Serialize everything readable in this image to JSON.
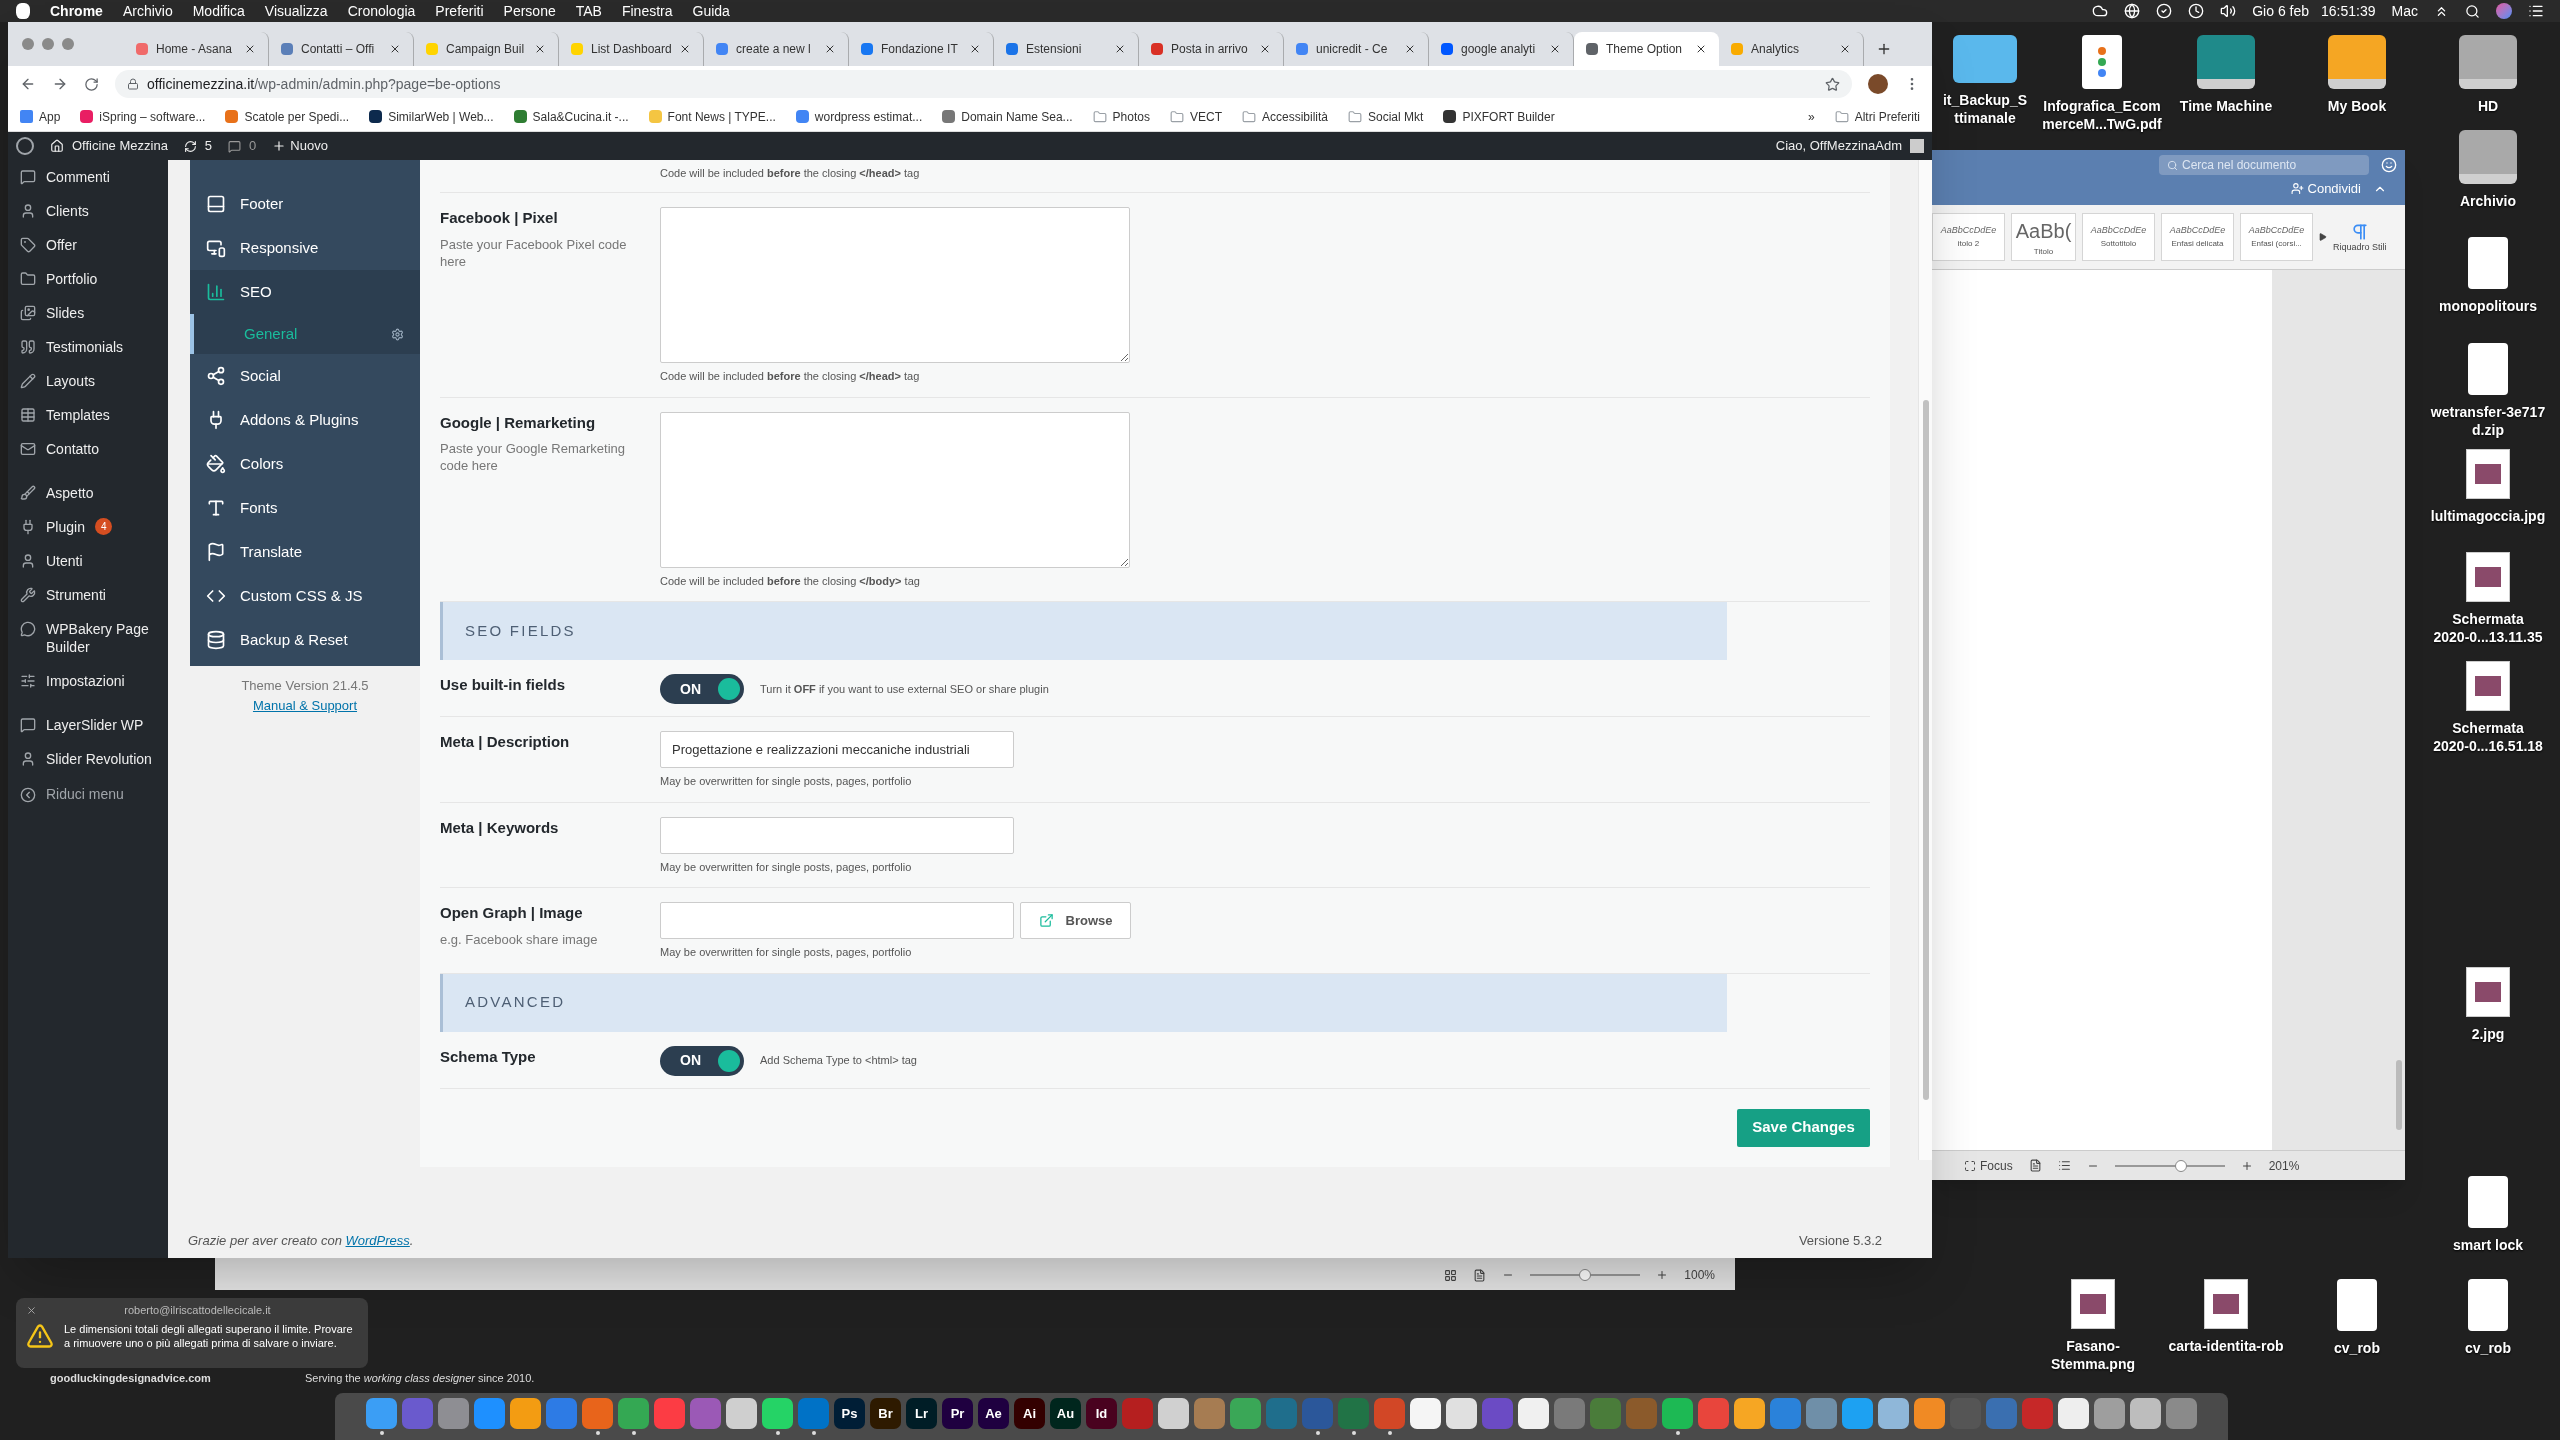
{
  "mac_menubar": {
    "app": "Chrome",
    "menus": [
      "Archivio",
      "Modifica",
      "Visualizza",
      "Cronologia",
      "Preferiti",
      "Persone",
      "TAB",
      "Finestra",
      "Guida"
    ],
    "date": "Gio 6 feb",
    "time": "16:51:39",
    "user": "Mac"
  },
  "browser": {
    "tabs": [
      {
        "title": "Home - Asana",
        "color": "#f06a6a",
        "selected": false
      },
      {
        "title": "Contatti – Offi",
        "color": "#5b7fb8",
        "selected": false
      },
      {
        "title": "Campaign Buil",
        "color": "#ffd400",
        "selected": false
      },
      {
        "title": "List Dashboard",
        "color": "#ffd400",
        "selected": false
      },
      {
        "title": "create a new l",
        "color": "#4285f4",
        "selected": false
      },
      {
        "title": "Fondazione IT",
        "color": "#1877f2",
        "selected": false
      },
      {
        "title": "Estensioni",
        "color": "#1a73e8",
        "selected": false
      },
      {
        "title": "Posta in arrivo",
        "color": "#d93025",
        "selected": false
      },
      {
        "title": "unicredit - Ce",
        "color": "#4285f4",
        "selected": false
      },
      {
        "title": "google analyti",
        "color": "#0057ff",
        "selected": false
      },
      {
        "title": "Theme Option",
        "color": "#5f6368",
        "selected": true
      },
      {
        "title": "Analytics",
        "color": "#f9ab00",
        "selected": false
      }
    ],
    "url_host": "officinemezzina.it",
    "url_path": "/wp-admin/admin.php?page=be-options",
    "bookmarks": [
      {
        "label": "App",
        "kind": "apps",
        "color": "#4285f4"
      },
      {
        "label": "iSpring – software...",
        "kind": "site",
        "color": "#e91e63"
      },
      {
        "label": "Scatole per Spedi...",
        "kind": "site",
        "color": "#e8711a"
      },
      {
        "label": "SimilarWeb | Web...",
        "kind": "site",
        "color": "#0d2a4d"
      },
      {
        "label": "Sala&Cucina.it -...",
        "kind": "site",
        "color": "#2e7d32"
      },
      {
        "label": "Font News | TYPE...",
        "kind": "site",
        "color": "#f4c542"
      },
      {
        "label": "wordpress estimat...",
        "kind": "site",
        "color": "#4285f4"
      },
      {
        "label": "Domain Name Sea...",
        "kind": "site",
        "color": "#777777"
      },
      {
        "label": "Photos",
        "kind": "folder",
        "color": "#9aa0a6"
      },
      {
        "label": "VECT",
        "kind": "folder",
        "color": "#9aa0a6"
      },
      {
        "label": "Accessibilità",
        "kind": "folder",
        "color": "#9aa0a6"
      },
      {
        "label": "Social Mkt",
        "kind": "folder",
        "color": "#9aa0a6"
      },
      {
        "label": "PIXFORT Builder",
        "kind": "site",
        "color": "#333333"
      }
    ],
    "more": "»",
    "other": "Altri Preferiti"
  },
  "admin_bar": {
    "site": "Officine Mezzina",
    "updates": "5",
    "comments": "0",
    "new": "Nuovo",
    "greeting": "Ciao, OffMezzinaAdm"
  },
  "wp_menu": {
    "groups": [
      [
        {
          "label": "Commenti"
        },
        {
          "label": "Clients"
        },
        {
          "label": "Offer"
        },
        {
          "label": "Portfolio"
        },
        {
          "label": "Slides"
        },
        {
          "label": "Testimonials"
        },
        {
          "label": "Layouts"
        },
        {
          "label": "Templates"
        },
        {
          "label": "Contatto"
        }
      ],
      [
        {
          "label": "Aspetto"
        },
        {
          "label": "Plugin",
          "badge": "4"
        },
        {
          "label": "Utenti"
        },
        {
          "label": "Strumenti"
        },
        {
          "label": "WPBakery Page Builder"
        },
        {
          "label": "Impostazioni"
        }
      ],
      [
        {
          "label": "LayerSlider WP"
        },
        {
          "label": "Slider Revolution"
        }
      ]
    ],
    "collapse": "Riduci menu"
  },
  "theme_nav": {
    "items": [
      {
        "label": "Footer",
        "selected": false
      },
      {
        "label": "Responsive",
        "selected": false
      },
      {
        "label": "SEO",
        "selected": true,
        "children": [
          {
            "label": "General",
            "selected": true
          }
        ]
      },
      {
        "label": "Social",
        "selected": false
      },
      {
        "label": "Addons & Plugins",
        "selected": false
      },
      {
        "label": "Colors",
        "selected": false
      },
      {
        "label": "Fonts",
        "selected": false
      },
      {
        "label": "Translate",
        "selected": false
      },
      {
        "label": "Custom CSS & JS",
        "selected": false
      },
      {
        "label": "Backup & Reset",
        "selected": false
      }
    ],
    "version": "Theme Version 21.4.5",
    "support_link": "Manual & Support"
  },
  "form": {
    "top_note": "Code will be included **before** the closing **</head>** tag",
    "rows": [
      {
        "kind": "textarea",
        "label": "Facebook | Pixel",
        "hint": "Paste your Facebook Pixel code here",
        "note": "Code will be included **before** the closing **</head>** tag"
      },
      {
        "kind": "textarea",
        "label": "Google | Remarketing",
        "hint": "Paste your Google Remarketing code here",
        "note": "Code will be included **before** the closing **</body>** tag"
      },
      {
        "kind": "section",
        "title": "SEO FIELDS"
      },
      {
        "kind": "toggle",
        "label": "Use built-in fields",
        "toggle": "ON",
        "on": true,
        "note": "Turn it **OFF** if you want to use external SEO or share plugin"
      },
      {
        "kind": "input",
        "label": "Meta | Description",
        "value": "Progettazione e realizzazioni meccaniche industriali",
        "note": "May be overwritten for single posts, pages, portfolio"
      },
      {
        "kind": "input",
        "label": "Meta | Keywords",
        "note": "May be overwritten for single posts, pages, portfolio"
      },
      {
        "kind": "image",
        "label": "Open Graph | Image",
        "hint": "e.g. Facebook share image",
        "button": "Browse",
        "note": "May be overwritten for single posts, pages, portfolio"
      },
      {
        "kind": "section",
        "title": "ADVANCED"
      },
      {
        "kind": "toggle",
        "label": "Schema Type",
        "toggle": "ON",
        "on": true,
        "note": "Add Schema Type to <html> tag"
      }
    ],
    "save_button": "Save Changes"
  },
  "wp_footer": {
    "thanks": "Grazie per aver creato con",
    "link": "WordPress",
    "after": ".",
    "version": "Versione 5.3.2"
  },
  "word_window": {
    "search_placeholder": "Cerca nel documento",
    "share": "Condividi",
    "styles": [
      {
        "sample": "AaBbCcDdEe",
        "name": "itolo 2"
      },
      {
        "sample": "AaBb(",
        "name": "Titolo"
      },
      {
        "sample": "AaBbCcDdEe",
        "name": "Sottotitolo"
      },
      {
        "sample": "AaBbCcDdEe",
        "name": "Enfasi delicata"
      },
      {
        "sample": "AaBbCcDdEe",
        "name": "Enfasi (corsi..."
      }
    ],
    "styles_pane": "Riquadro Stili",
    "focus": "Focus",
    "zoom": "201%",
    "zoom_slider": {
      "level": 0.6
    }
  },
  "back_window": {
    "zoom": "100%",
    "zoom_slider": {
      "level": 0.5
    }
  },
  "desktop_icons": [
    {
      "lines": [
        "it_Backup_S",
        "ttimanale"
      ],
      "kind": "folder"
    },
    {
      "lines": [
        "Infografica_Ecom",
        "merceM...TwG.pdf"
      ],
      "kind": "pdf"
    },
    {
      "lines": [
        "Time Machine"
      ],
      "kind": "drive",
      "color": "#1f8a8a"
    },
    {
      "lines": [
        "My Book"
      ],
      "kind": "drive",
      "color": "#f5a623"
    },
    {
      "lines": [
        "HD"
      ],
      "kind": "drive",
      "color": "#a9a9a9"
    },
    {
      "lines": [
        "Archivio"
      ],
      "kind": "drive",
      "color": "#a9a9a9"
    },
    {
      "lines": [
        "monopolitours"
      ],
      "kind": "doc"
    },
    {
      "lines": [
        "wetransfer-3e717",
        "d.zip"
      ],
      "kind": "doc"
    },
    {
      "lines": [
        "lultimagoccia.jpg"
      ],
      "kind": "image"
    },
    {
      "lines": [
        "Schermata",
        "2020-0...13.11.35"
      ],
      "kind": "image"
    },
    {
      "lines": [
        "Schermata",
        "2020-0...16.51.18"
      ],
      "kind": "image"
    },
    {
      "lines": [
        "2.jpg"
      ],
      "kind": "image"
    },
    {
      "lines": [
        "smart lock"
      ],
      "kind": "doc"
    },
    {
      "lines": [
        "Fasano-",
        "Stemma.png"
      ],
      "kind": "image"
    },
    {
      "lines": [
        "carta-identita-rob"
      ],
      "kind": "image"
    },
    {
      "lines": [
        "cv_rob"
      ],
      "kind": "doc"
    },
    {
      "lines": [
        "cv_rob"
      ],
      "kind": "doc"
    }
  ],
  "notification": {
    "sender": "roberto@ilriscattodellecicale.it",
    "message": "Le dimensioni totali degli allegati superano il limite. Provare a rimuovere uno o più allegati prima di salvare o inviare."
  },
  "background_texts": [
    "goodluckingdesignadvice.com",
    "Serving the *working class designer* since 2010."
  ],
  "dock": [
    {
      "color": "#3b9ef5",
      "running": true
    },
    {
      "color": "#6a5acd",
      "running": false
    },
    {
      "color": "#8e8e93",
      "running": false
    },
    {
      "color": "#1e90ff",
      "running": false
    },
    {
      "color": "#f39c12",
      "running": false
    },
    {
      "color": "#2d7be5",
      "running": false
    },
    {
      "color": "#e8641b",
      "running": true
    },
    {
      "color": "#34a853",
      "running": true
    },
    {
      "color": "#fc3c44",
      "running": false
    },
    {
      "color": "#9b59b6",
      "running": false
    },
    {
      "color": "#cfcfcf",
      "running": false
    },
    {
      "color": "#25d366",
      "running": true
    },
    {
      "color": "#0072c6",
      "running": true
    },
    {
      "color": "#001e36",
      "label": "Ps",
      "running": false
    },
    {
      "color": "#2e1a00",
      "label": "Br",
      "running": false
    },
    {
      "color": "#001d26",
      "label": "Lr",
      "running": false
    },
    {
      "color": "#1f0040",
      "label": "Pr",
      "running": false
    },
    {
      "color": "#1f0040",
      "label": "Ae",
      "running": false
    },
    {
      "color": "#330000",
      "label": "Ai",
      "running": false
    },
    {
      "color": "#00261d",
      "label": "Au",
      "running": false
    },
    {
      "color": "#49021f",
      "label": "Id",
      "running": false
    },
    {
      "color": "#b51f1f",
      "running": false
    },
    {
      "color": "#d0d0d0",
      "running": false
    },
    {
      "color": "#a67c52",
      "running": false
    },
    {
      "color": "#3aa757",
      "running": false
    },
    {
      "color": "#1f6e8c",
      "running": false
    },
    {
      "color": "#2b579a",
      "running": true
    },
    {
      "color": "#217346",
      "running": true
    },
    {
      "color": "#d24726",
      "running": true
    },
    {
      "color": "#f5f5f5",
      "running": false
    },
    {
      "color": "#e0e0e0",
      "running": false
    },
    {
      "color": "#6b4bc4",
      "running": false
    },
    {
      "color": "#f0f0f0",
      "running": false
    },
    {
      "color": "#7a7a7a",
      "running": false
    },
    {
      "color": "#4a7c3a",
      "running": false
    },
    {
      "color": "#8b5a2b",
      "running": false
    },
    {
      "color": "#1db954",
      "running": true
    },
    {
      "color": "#e8453c",
      "running": false
    },
    {
      "color": "#f6a623",
      "running": false
    },
    {
      "color": "#2a82da",
      "running": false
    },
    {
      "color": "#6f8fa8",
      "running": false
    },
    {
      "color": "#1da1f2",
      "running": false
    },
    {
      "color": "#8fb7d9",
      "running": false
    },
    {
      "color": "#f08a24",
      "running": false
    },
    {
      "color": "#555555",
      "running": false
    },
    {
      "color": "#3a6fb0",
      "running": false
    },
    {
      "color": "#c62828",
      "running": false
    },
    {
      "color": "#eeeeee",
      "running": false
    },
    {
      "color": "#9e9e9e",
      "running": false
    },
    {
      "color": "#bdbdbd",
      "running": false
    },
    {
      "color": "#8a8a8a",
      "running": false
    }
  ]
}
